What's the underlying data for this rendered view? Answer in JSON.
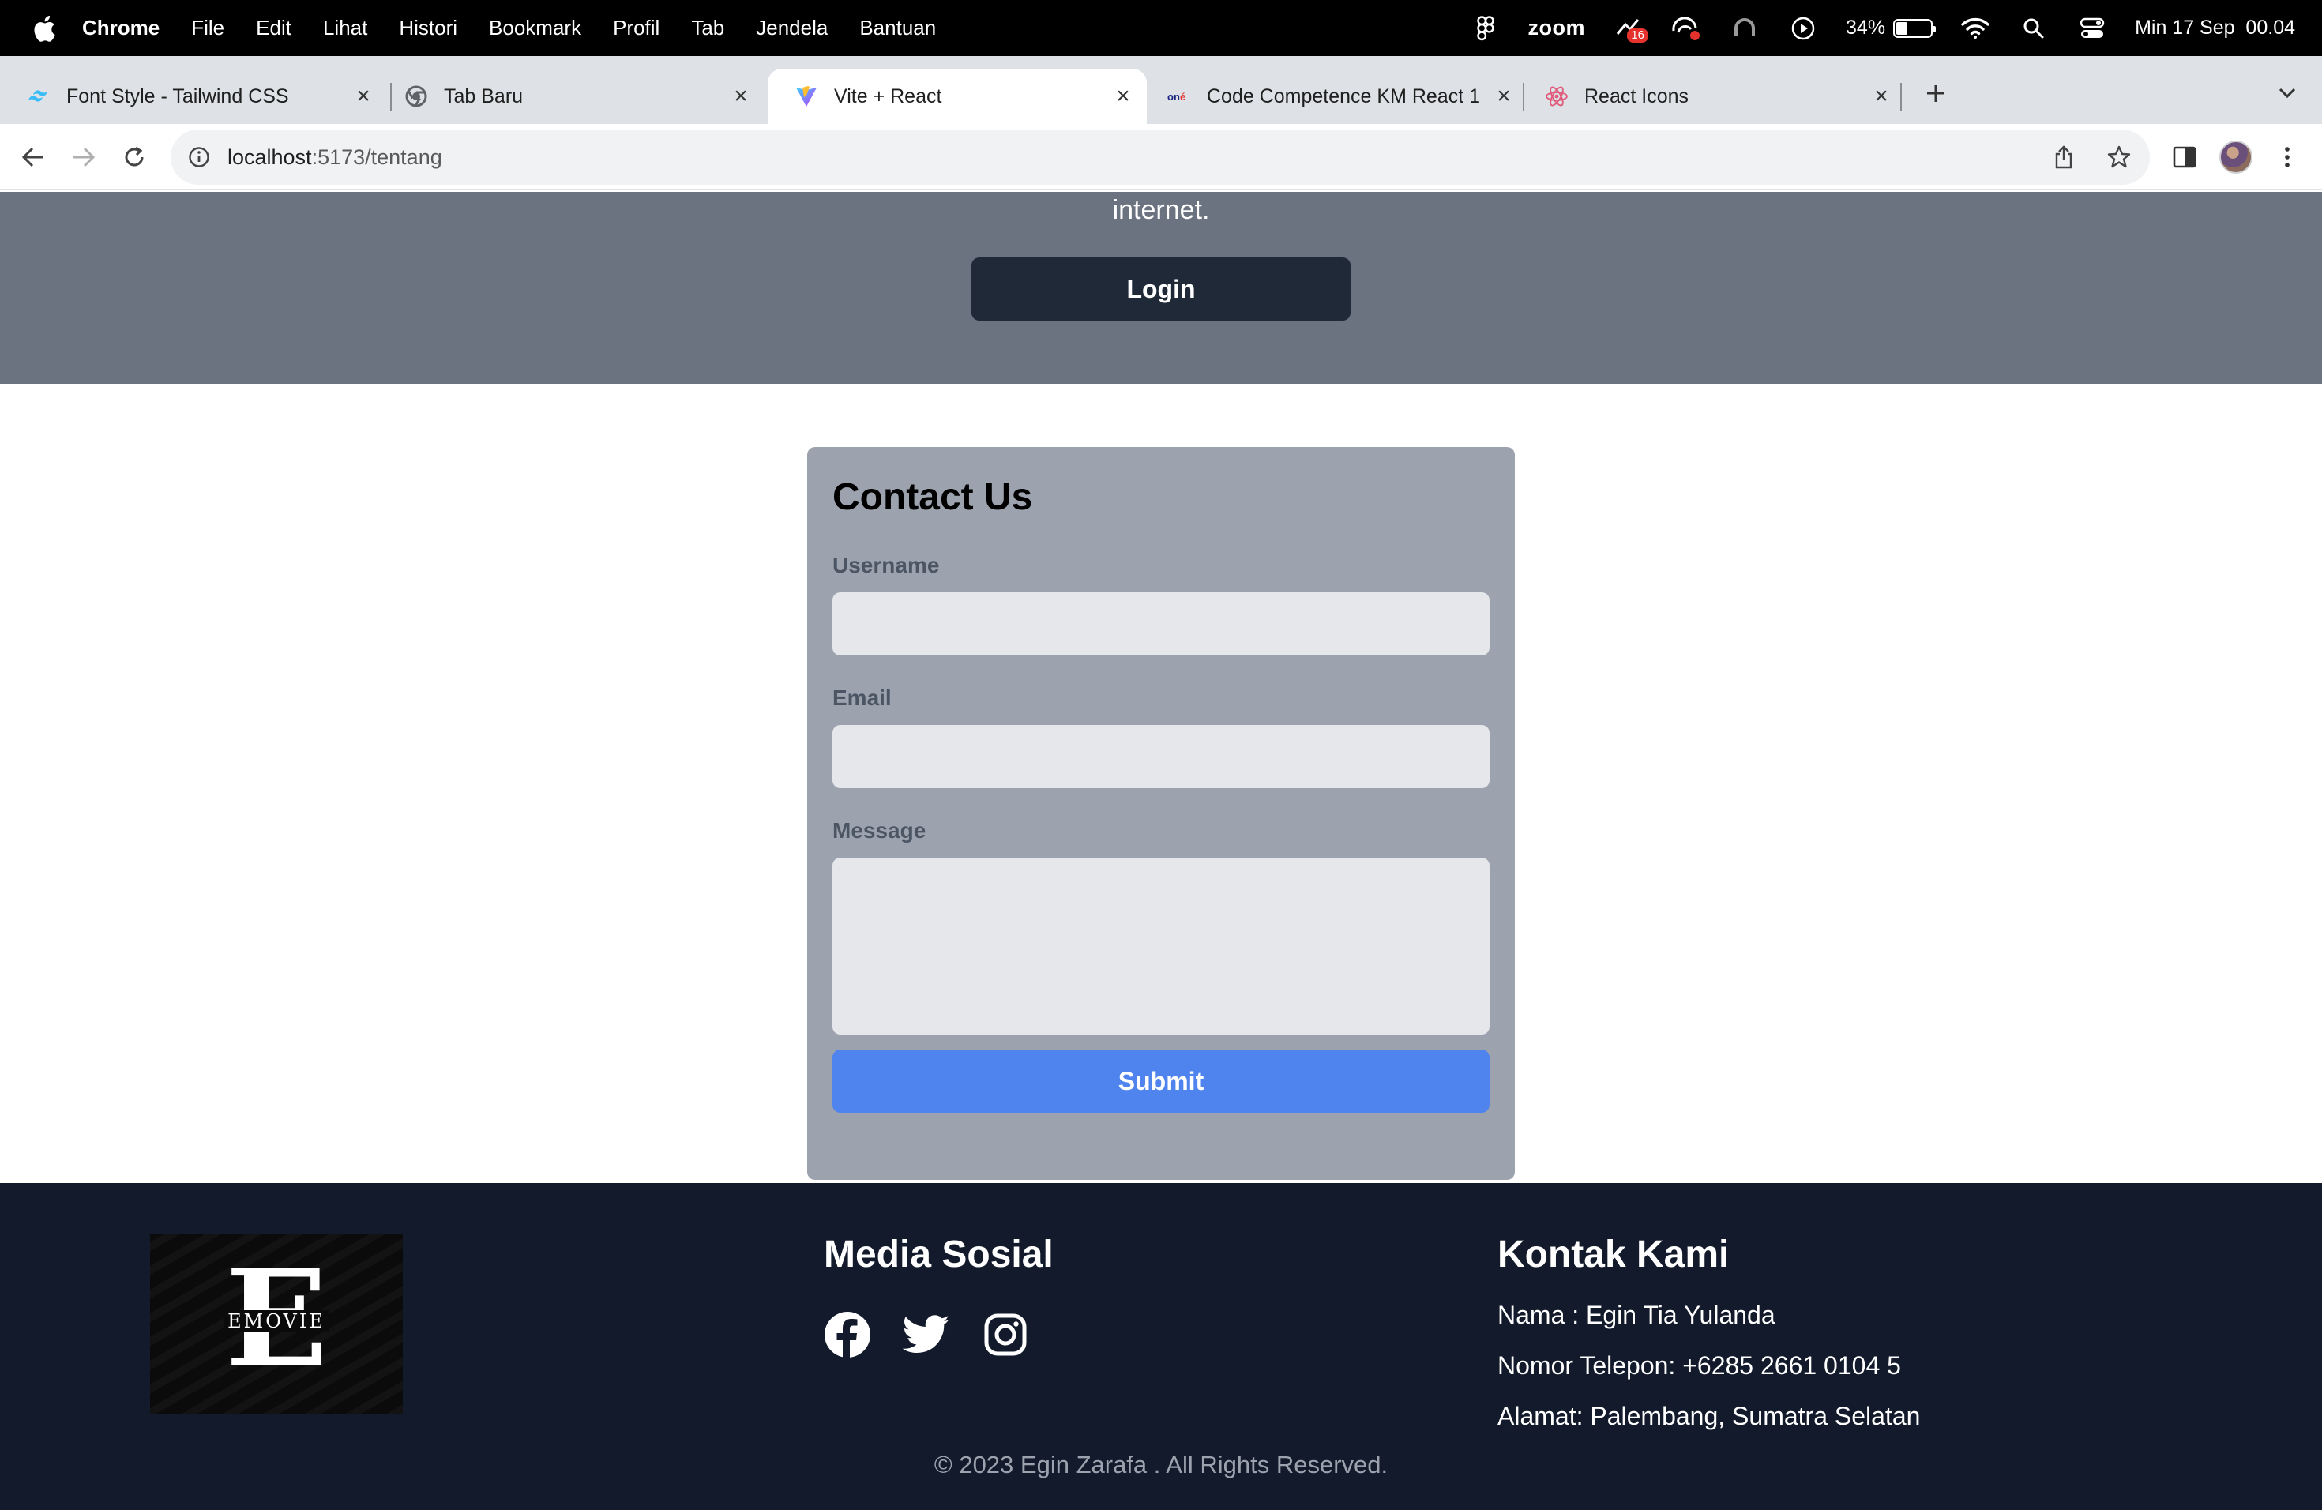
{
  "menubar": {
    "app": "Chrome",
    "items": [
      "File",
      "Edit",
      "Lihat",
      "Histori",
      "Bookmark",
      "Profil",
      "Tab",
      "Jendela",
      "Bantuan"
    ],
    "zoom_label": "zoom",
    "notification_count": "16",
    "battery": "34%",
    "battery_level": 0.34,
    "datetime": "Min 17 Sep  00.04"
  },
  "tabs": [
    {
      "title": "Font Style - Tailwind CSS",
      "icon": "tailwind-icon"
    },
    {
      "title": "Tab Baru",
      "icon": "chrome-icon"
    },
    {
      "title": "Vite + React",
      "icon": "vite-icon",
      "active": true
    },
    {
      "title": "Code Competence KM React 1",
      "icon": "one-icon"
    },
    {
      "title": "React Icons",
      "icon": "react-icon"
    }
  ],
  "address": {
    "host": "localhost",
    "path": ":5173/tentang"
  },
  "hero": {
    "tail_text": "internet.",
    "login_label": "Login"
  },
  "contact": {
    "title": "Contact Us",
    "username_label": "Username",
    "username_value": "",
    "email_label": "Email",
    "email_value": "",
    "message_label": "Message",
    "message_value": "",
    "submit_label": "Submit"
  },
  "footer": {
    "logo_letter": "E",
    "logo_text": "EMOVIE",
    "social_heading": "Media Sosial",
    "social_icons": [
      "facebook-icon",
      "twitter-icon",
      "instagram-icon"
    ],
    "contact_heading": "Kontak Kami",
    "name_line": "Nama : Egin Tia Yulanda",
    "phone_line": "Nomor Telepon: +6285 2661 0104 5",
    "address_line": "Alamat: Palembang, Sumatra Selatan",
    "copyright": "© 2023 Egin Zarafa . All Rights Reserved."
  },
  "colors": {
    "hero_bg": "#6b7280",
    "login_bg": "#1f2937",
    "card_bg": "#9ca3af",
    "input_bg": "#e5e7eb",
    "submit_bg": "#4f84ee",
    "footer_bg": "#121a2b"
  }
}
